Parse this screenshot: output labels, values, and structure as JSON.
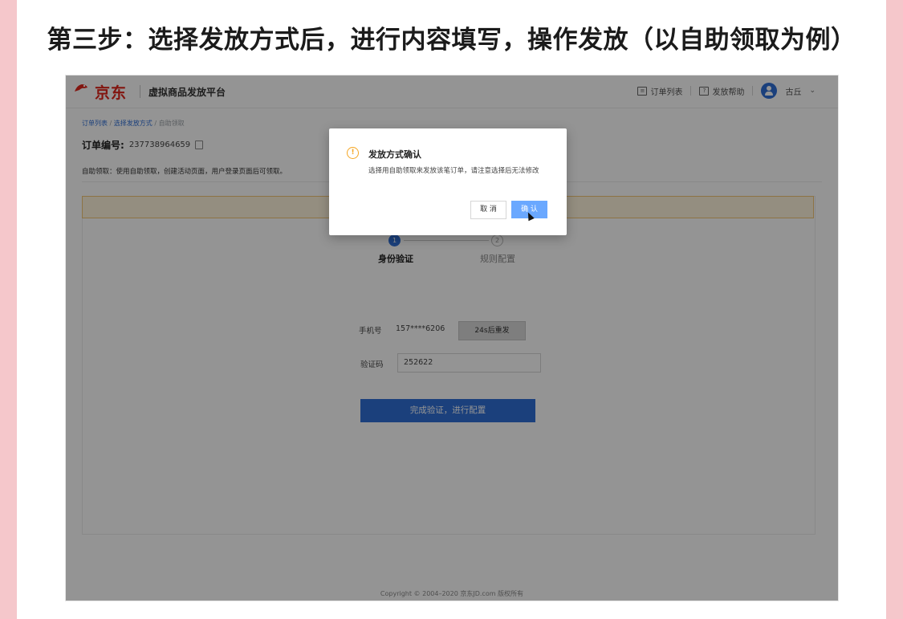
{
  "page_title": "第三步：选择发放方式后，进行内容填写，操作发放（以自助领取为例）",
  "app": {
    "logo_text": "京东",
    "platform_name": "虚拟商品发放平台",
    "top_links": [
      "订单列表",
      "发放帮助"
    ],
    "user_name": "古丘"
  },
  "breadcrumb": [
    "订单列表",
    "选择发放方式",
    "自助领取"
  ],
  "order": {
    "label": "订单编号:",
    "number": "237738964659"
  },
  "tip": "自助领取：使用自助领取，创建活动页面，用户登录页面后可领取。",
  "steps": [
    {
      "index": "1",
      "label": "身份验证"
    },
    {
      "index": "2",
      "label": "规则配置"
    }
  ],
  "form": {
    "phone_label": "手机号",
    "phone_value": "157****6206",
    "resend_label": "24s后重发",
    "code_label": "验证码",
    "code_value": "252622",
    "submit_label": "完成验证，进行配置"
  },
  "footer": "Copyright © 2004–2020 京东JD.com 版权所有",
  "modal": {
    "title": "发放方式确认",
    "body": "选择用自助领取来发放该笔订单，请注意选择后无法修改",
    "cancel_label": "取 消",
    "confirm_label": "确 认"
  },
  "colors": {
    "side_border": "#f5c7cb",
    "brand_red": "#e1251b",
    "primary_blue": "#2f6fd6",
    "warning": "#f5a623"
  }
}
